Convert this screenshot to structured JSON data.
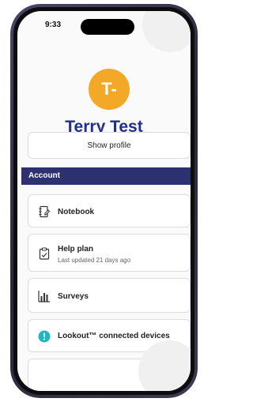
{
  "status_bar": {
    "time": "9:33",
    "battery": "92"
  },
  "profile": {
    "initials": "T-",
    "name": "Terry Test",
    "show_profile_label": "Show profile"
  },
  "section": {
    "title": "Account"
  },
  "items": [
    {
      "title": "Notebook",
      "icon": "notebook-icon"
    },
    {
      "title": "Help plan",
      "subtitle": "Last updated 21 days ago",
      "icon": "clipboard-icon"
    },
    {
      "title": "Surveys",
      "icon": "bar-chart-icon"
    },
    {
      "title": "Lookout™ connected devices",
      "icon": "info-circle-icon"
    }
  ],
  "colors": {
    "avatar": "#f3a827",
    "name": "#1f2f8a",
    "section_header": "#2d3170",
    "info_icon": "#1fb6c6"
  }
}
